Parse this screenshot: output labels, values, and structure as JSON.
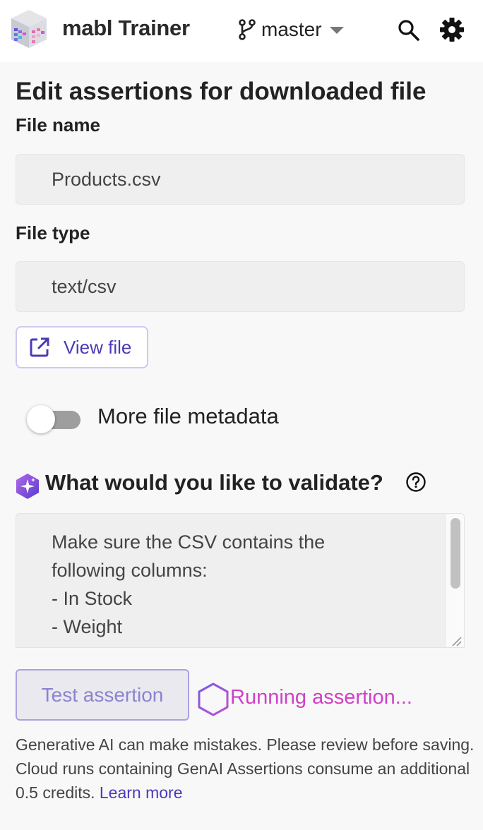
{
  "header": {
    "app_title": "mabl Trainer",
    "branch": "master",
    "icons": {
      "logo": "mabl-logo-icon",
      "branch": "git-branch-icon",
      "caret": "caret-down-icon",
      "search": "search-icon",
      "settings": "gear-icon"
    }
  },
  "main": {
    "title": "Edit assertions for downloaded file",
    "file_name": {
      "label": "File name",
      "value": "Products.csv"
    },
    "file_type": {
      "label": "File type",
      "value": "text/csv"
    },
    "view_file_label": "View file",
    "metadata_toggle": {
      "label": "More file metadata",
      "enabled": false
    },
    "validate": {
      "title": "What would you like to validate?",
      "prompt": "Make sure the CSV contains the\nfollowing columns:\n- In Stock\n- Weight\n- Name"
    },
    "test_button_label": "Test assertion",
    "running_status": "Running assertion...",
    "disclaimer": {
      "text": "Generative AI can make mistakes. Please review before saving. Cloud runs containing GenAI Assertions consume an additional 0.5 credits.",
      "link_label": "Learn more"
    }
  },
  "colors": {
    "accent": "#4a3ab8",
    "running": "#d040c8",
    "field_bg": "#efefef",
    "page_bg": "#f8f8f8"
  }
}
